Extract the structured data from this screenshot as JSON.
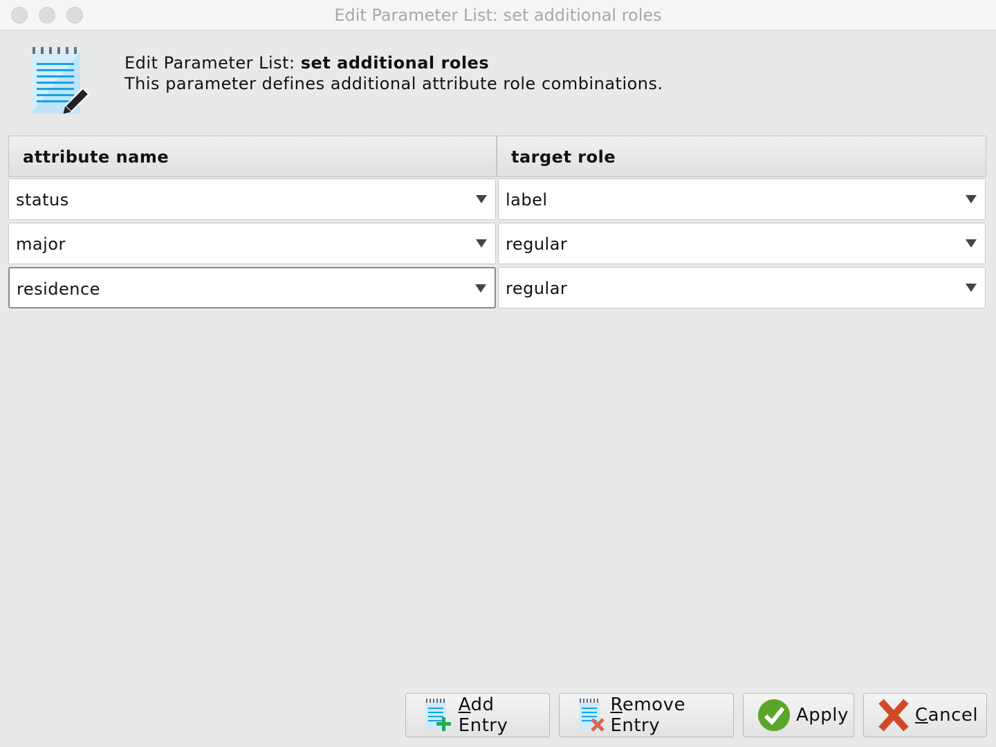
{
  "window": {
    "title": "Edit Parameter List: set additional roles"
  },
  "header": {
    "title_prefix": "Edit Parameter List: ",
    "title_name": "set additional roles",
    "description": "This parameter defines additional attribute role combinations.",
    "icon": "notepad-pencil-icon"
  },
  "table": {
    "columns": [
      "attribute name",
      "target role"
    ],
    "rows": [
      {
        "attribute": "status",
        "role": "label"
      },
      {
        "attribute": "major",
        "role": "regular"
      },
      {
        "attribute": "residence",
        "role": "regular"
      }
    ]
  },
  "buttons": {
    "add": {
      "mnemonic": "A",
      "rest": "dd Entry",
      "icon": "notepad-plus-icon"
    },
    "remove": {
      "mnemonic": "R",
      "rest": "emove Entry",
      "icon": "notepad-x-icon"
    },
    "apply": {
      "mnemonic": "",
      "rest": "Apply",
      "icon": "green-check-icon"
    },
    "cancel": {
      "mnemonic": "C",
      "rest": "ancel",
      "icon": "red-x-icon"
    }
  }
}
